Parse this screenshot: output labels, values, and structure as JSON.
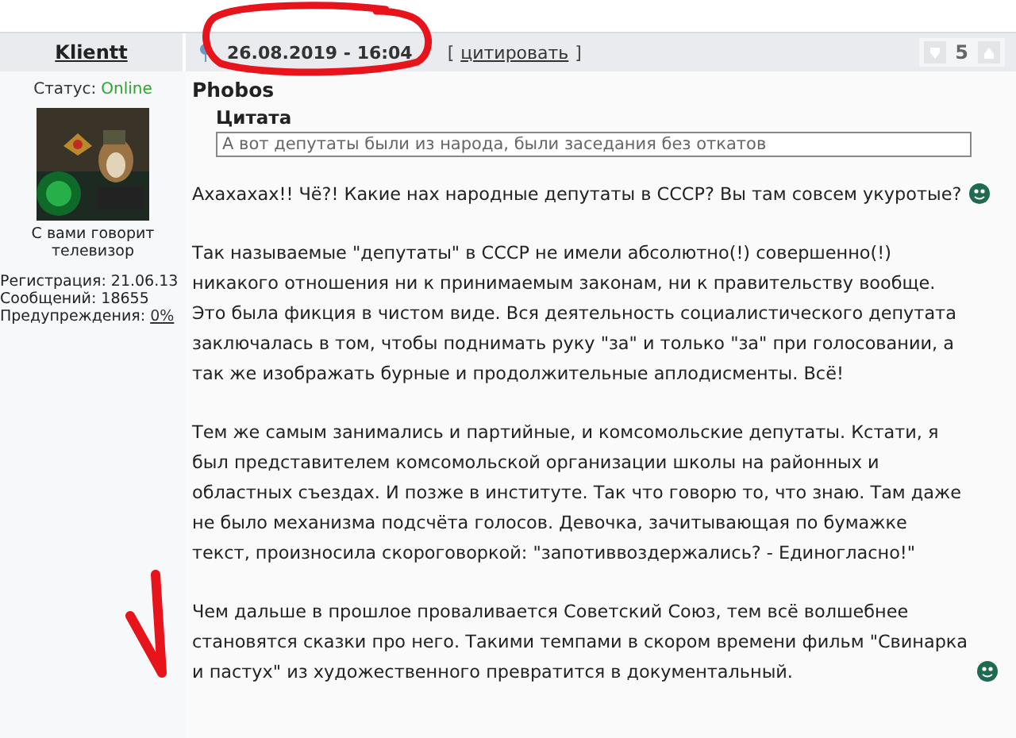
{
  "author": {
    "name": "Klientt",
    "status_label": "Статус:",
    "status": "Online",
    "online": true,
    "title": "С вами говорит телевизор",
    "stats": [
      {
        "label": "Регистрация:",
        "value": "21.06.13",
        "link": false
      },
      {
        "label": "Сообщений:",
        "value": "18655",
        "link": false
      },
      {
        "label": "Предупреждения:",
        "value": "0%",
        "link": true
      }
    ]
  },
  "post": {
    "date": "26.08.2019 - 16:04",
    "quote_open": "[",
    "quote_action": "цитировать",
    "quote_close": "]",
    "rating": "5",
    "quoted_author": "Phobos",
    "quote_title": "Цитата",
    "quote_text": "А вот депутаты были из народа, были заседания без откатов",
    "paragraphs": [
      {
        "text": "Ахахахах!! Чё?! Какие нах народные депутаты в СССР? Вы там совсем укуротые?",
        "smiley": true
      },
      {
        "text": "Так называемые \"депутаты\" в СССР не имели абсолютно(!) совершенно(!) никакого отношения ни к принимаемым законам, ни к правительству вообще. Это была фикция в чистом виде. Вся деятельность социалистического депутата заключалась в том, чтобы поднимать руку \"за\" и только \"за\" при голосовании, а так же изображать бурные и продолжительные аплодисменты. Всё!",
        "smiley": false
      },
      {
        "text": "Тем же самым занимались и партийные, и комсомольские депутаты. Кстати, я был представителем комсомольской организации школы на районных и областных съездах. И позже в институте. Так что говорю то, что знаю. Там даже не было механизма подсчёта голосов. Девочка, зачитывающая по бумажке текст, произносила скороговоркой: \"запотиввоздержались? - Единогласно!\"",
        "smiley": false
      },
      {
        "text": "Чем дальше в прошлое проваливается Советский Союз, тем всё волшебнее становятся сказки про него. Такими темпами в скором времени фильм \"Свинарка и пастух\" из художественного превратится в документальный.",
        "smiley": true
      }
    ]
  }
}
